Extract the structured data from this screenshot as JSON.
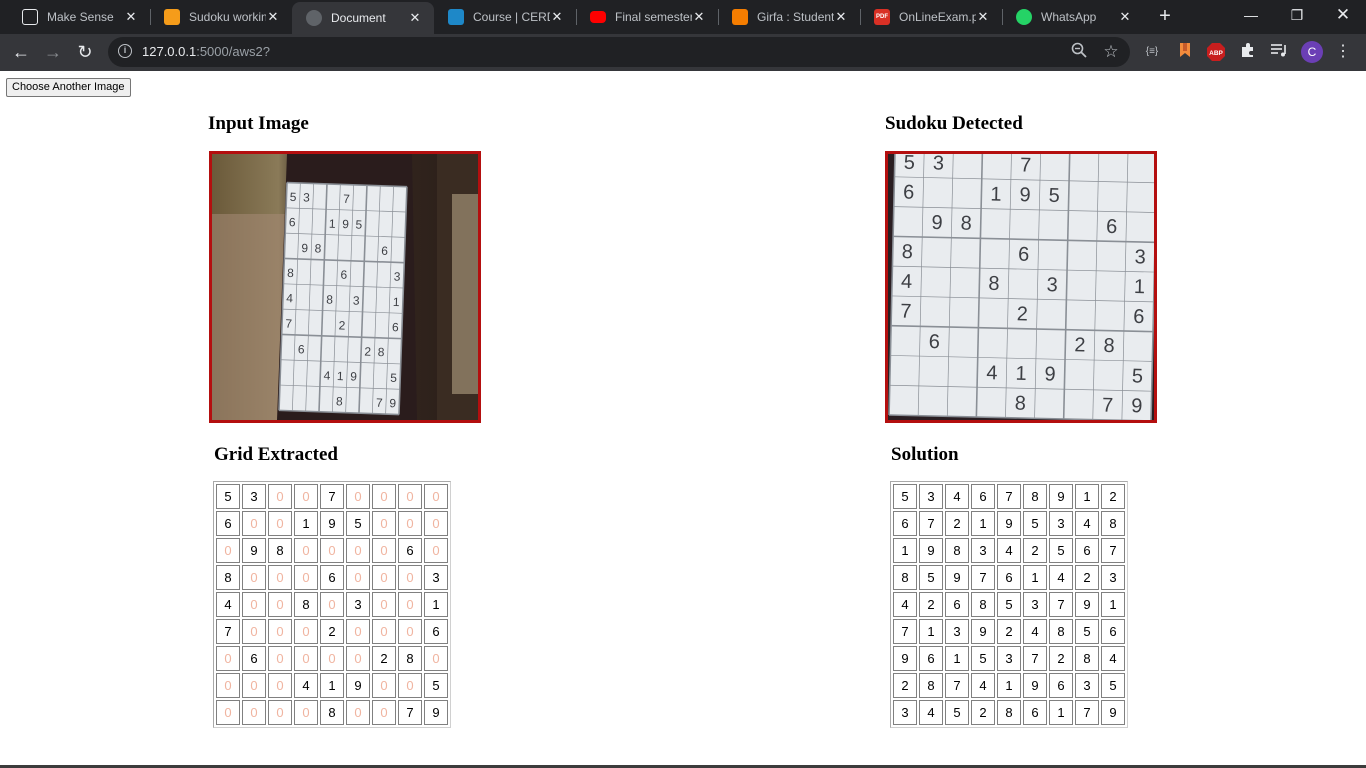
{
  "browser": {
    "tabs": [
      {
        "title": "Make Sense",
        "icon": "make-sense-icon",
        "color": "#202124"
      },
      {
        "title": "Sudoku workin",
        "icon": "hourglass-icon",
        "color": "#f59c1a"
      },
      {
        "title": "Document",
        "icon": "globe-icon",
        "color": "#5f6368",
        "active": true
      },
      {
        "title": "Course | CERD",
        "icon": "course-icon",
        "color": "#1e88c8"
      },
      {
        "title": "Final semester",
        "icon": "youtube-icon",
        "color": "#ff0000"
      },
      {
        "title": "Girfa : Student",
        "icon": "blogger-icon",
        "color": "#f57d00"
      },
      {
        "title": "OnLineExam.p",
        "icon": "pdf-icon",
        "color": "#d93025"
      },
      {
        "title": "WhatsApp",
        "icon": "whatsapp-icon",
        "color": "#25d366"
      }
    ],
    "url_host": "127.0.0.1",
    "url_path": ":5000/aws2?",
    "profile_initial": "C",
    "pdf_label": "PDF",
    "abp_label": "ABP"
  },
  "page": {
    "choose_button": "Choose Another Image",
    "input_title": "Input Image",
    "detected_title": "Sudoku Detected",
    "grid_title": "Grid Extracted",
    "solution_title": "Solution",
    "accent_border": "#b40f0f",
    "zero_color": "#f0b4a0"
  },
  "grid_extracted": [
    [
      5,
      3,
      0,
      0,
      7,
      0,
      0,
      0,
      0
    ],
    [
      6,
      0,
      0,
      1,
      9,
      5,
      0,
      0,
      0
    ],
    [
      0,
      9,
      8,
      0,
      0,
      0,
      0,
      6,
      0
    ],
    [
      8,
      0,
      0,
      0,
      6,
      0,
      0,
      0,
      3
    ],
    [
      4,
      0,
      0,
      8,
      0,
      3,
      0,
      0,
      1
    ],
    [
      7,
      0,
      0,
      0,
      2,
      0,
      0,
      0,
      6
    ],
    [
      0,
      6,
      0,
      0,
      0,
      0,
      2,
      8,
      0
    ],
    [
      0,
      0,
      0,
      4,
      1,
      9,
      0,
      0,
      5
    ],
    [
      0,
      0,
      0,
      0,
      8,
      0,
      0,
      7,
      9
    ]
  ],
  "solution": [
    [
      5,
      3,
      4,
      6,
      7,
      8,
      9,
      1,
      2
    ],
    [
      6,
      7,
      2,
      1,
      9,
      5,
      3,
      4,
      8
    ],
    [
      1,
      9,
      8,
      3,
      4,
      2,
      5,
      6,
      7
    ],
    [
      8,
      5,
      9,
      7,
      6,
      1,
      4,
      2,
      3
    ],
    [
      4,
      2,
      6,
      8,
      5,
      3,
      7,
      9,
      1
    ],
    [
      7,
      1,
      3,
      9,
      2,
      4,
      8,
      5,
      6
    ],
    [
      9,
      6,
      1,
      5,
      3,
      7,
      2,
      8,
      4
    ],
    [
      2,
      8,
      7,
      4,
      1,
      9,
      6,
      3,
      5
    ],
    [
      3,
      4,
      5,
      2,
      8,
      6,
      1,
      7,
      9
    ]
  ]
}
